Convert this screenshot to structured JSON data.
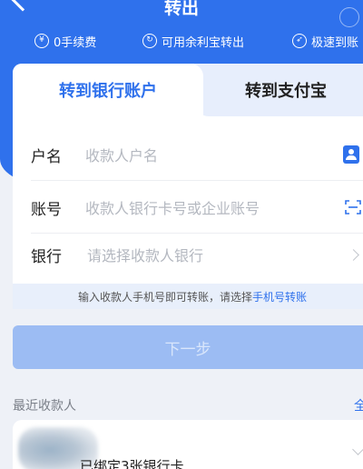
{
  "nav": {
    "title": "转出"
  },
  "features": [
    {
      "icon": "yen-icon",
      "label": "0手续费"
    },
    {
      "icon": "refresh-icon",
      "label": "可用余利宝转出"
    },
    {
      "icon": "rocket-icon",
      "label": "极速到账"
    }
  ],
  "tabs": {
    "bank": "转到银行账户",
    "alipay": "转到支付宝"
  },
  "form": {
    "name_label": "户名",
    "name_placeholder": "收款人户名",
    "account_label": "账号",
    "account_placeholder": "收款人银行卡号或企业账号",
    "bank_label": "银行",
    "bank_placeholder": "请选择收款人银行"
  },
  "tip": {
    "text": "输入收款人手机号即可转账，请选择",
    "link": "手机号转账"
  },
  "next_button": "下一步",
  "recent": {
    "title": "最近收款人",
    "all_link": "全",
    "item_text": "已绑定3张银行卡"
  },
  "colors": {
    "brand": "#2f71ec",
    "button_disabled": "#9cbcf3",
    "tip_bg": "#e8effb"
  }
}
